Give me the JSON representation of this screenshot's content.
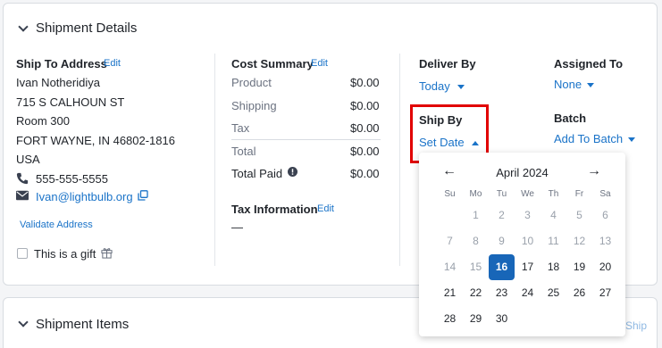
{
  "shipment_details": {
    "title": "Shipment Details"
  },
  "ship_to": {
    "label": "Ship To Address",
    "edit": "Edit",
    "name": "Ivan Notheridiya",
    "line1": "715 S CALHOUN ST",
    "line2": "Room 300",
    "city_state_zip": "FORT WAYNE, IN 46802-1816",
    "country": "USA",
    "phone": "555-555-5555",
    "email": "Ivan@lightbulb.org",
    "validate": "Validate Address",
    "gift_label": "This is a gift"
  },
  "cost_summary": {
    "label": "Cost Summary",
    "edit": "Edit",
    "rows": [
      {
        "name": "Product",
        "value": "$0.00"
      },
      {
        "name": "Shipping",
        "value": "$0.00"
      },
      {
        "name": "Tax",
        "value": "$0.00"
      },
      {
        "name": "Total",
        "value": "$0.00"
      },
      {
        "name": "Total Paid",
        "value": "$0.00"
      }
    ]
  },
  "tax_info": {
    "label": "Tax Information",
    "edit": "Edit",
    "value": "—"
  },
  "deliver_by": {
    "label": "Deliver By",
    "value": "Today"
  },
  "assigned_to": {
    "label": "Assigned To",
    "value": "None"
  },
  "ship_by": {
    "label": "Ship By",
    "value": "Set Date"
  },
  "batch": {
    "label": "Batch",
    "value": "Add To Batch"
  },
  "calendar": {
    "month": "April 2024",
    "prev": "←",
    "next": "→",
    "weekdays": [
      "Su",
      "Mo",
      "Tu",
      "We",
      "Th",
      "Fr",
      "Sa"
    ],
    "rows": [
      [
        "",
        "1",
        "2",
        "3",
        "4",
        "5",
        "6"
      ],
      [
        "7",
        "8",
        "9",
        "10",
        "11",
        "12",
        "13"
      ],
      [
        "14",
        "15",
        "16",
        "17",
        "18",
        "19",
        "20"
      ],
      [
        "21",
        "22",
        "23",
        "24",
        "25",
        "26",
        "27"
      ],
      [
        "28",
        "29",
        "30",
        "",
        "",
        "",
        ""
      ]
    ],
    "selected": "16",
    "disabled_through": 15
  },
  "shipment_items": {
    "title": "Shipment Items",
    "right_link": "Ship"
  },
  "colors": {
    "accent": "#1a73c8",
    "selected": "#1866b8",
    "highlight": "#e10000"
  }
}
